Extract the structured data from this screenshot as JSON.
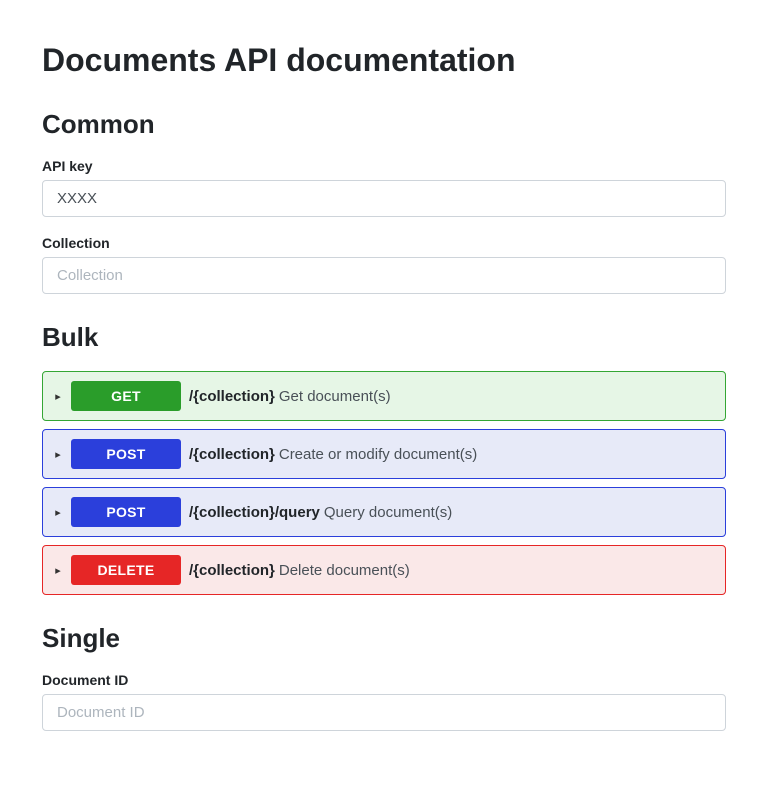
{
  "page": {
    "title": "Documents API documentation"
  },
  "common": {
    "heading": "Common",
    "apiKey": {
      "label": "API key",
      "value": "XXXX"
    },
    "collection": {
      "label": "Collection",
      "placeholder": "Collection",
      "value": ""
    }
  },
  "bulk": {
    "heading": "Bulk",
    "endpoints": [
      {
        "method": "GET",
        "path": "/{collection}",
        "description": "Get document(s)"
      },
      {
        "method": "POST",
        "path": "/{collection}",
        "description": "Create or modify document(s)"
      },
      {
        "method": "POST",
        "path": "/{collection}/query",
        "description": "Query document(s)"
      },
      {
        "method": "DELETE",
        "path": "/{collection}",
        "description": "Delete document(s)"
      }
    ]
  },
  "single": {
    "heading": "Single",
    "documentId": {
      "label": "Document ID",
      "placeholder": "Document ID",
      "value": ""
    }
  }
}
